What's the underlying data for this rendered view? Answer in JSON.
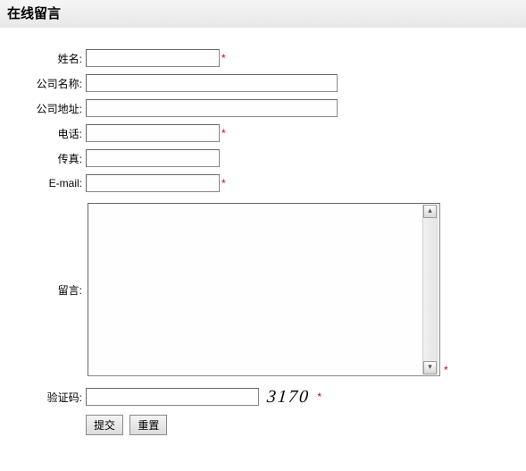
{
  "header": {
    "title": "在线留言"
  },
  "form": {
    "name": {
      "label": "姓名:",
      "value": "",
      "required": true
    },
    "company": {
      "label": "公司名称:",
      "value": "",
      "required": false
    },
    "address": {
      "label": "公司地址:",
      "value": "",
      "required": false
    },
    "phone": {
      "label": "电话:",
      "value": "",
      "required": true
    },
    "fax": {
      "label": "传真:",
      "value": "",
      "required": false
    },
    "email": {
      "label": "E-mail:",
      "value": "",
      "required": true
    },
    "message": {
      "label": "留言:",
      "value": "",
      "required": true
    },
    "captcha": {
      "label": "验证码:",
      "value": "",
      "code": "3170",
      "required": true
    }
  },
  "buttons": {
    "submit": "提交",
    "reset": "重置"
  },
  "marks": {
    "required": "*"
  }
}
